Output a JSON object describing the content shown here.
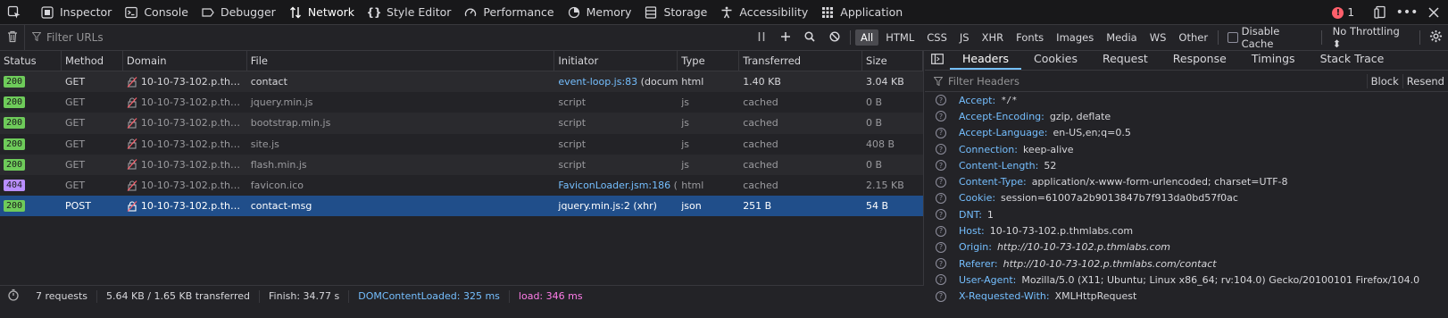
{
  "toolbar": {
    "tools": [
      {
        "label": "Inspector",
        "icon": "inspector-icon"
      },
      {
        "label": "Console",
        "icon": "console-icon"
      },
      {
        "label": "Debugger",
        "icon": "debugger-icon"
      },
      {
        "label": "Network",
        "icon": "network-icon",
        "selected": true
      },
      {
        "label": "Style Editor",
        "icon": "style-editor-icon"
      },
      {
        "label": "Performance",
        "icon": "performance-icon"
      },
      {
        "label": "Memory",
        "icon": "memory-icon"
      },
      {
        "label": "Storage",
        "icon": "storage-icon"
      },
      {
        "label": "Accessibility",
        "icon": "accessibility-icon"
      },
      {
        "label": "Application",
        "icon": "application-icon"
      }
    ],
    "error_count": "1"
  },
  "filterbar": {
    "filter_placeholder": "Filter URLs",
    "types": [
      "All",
      "HTML",
      "CSS",
      "JS",
      "XHR",
      "Fonts",
      "Images",
      "Media",
      "WS",
      "Other"
    ],
    "active_type": "All",
    "disable_cache_label": "Disable Cache",
    "throttling_label": "No Throttling ⬍"
  },
  "columns": [
    "Status",
    "Method",
    "Domain",
    "File",
    "Initiator",
    "Type",
    "Transferred",
    "Size"
  ],
  "requests": [
    {
      "status": "200",
      "method": "GET",
      "domain": "10-10-73-102.p.thmla…",
      "file": "contact",
      "initiator_link": "event-loop.js:83",
      "initiator_rest": " (docum…",
      "type": "html",
      "transferred": "1.40 KB",
      "size": "3.04 KB",
      "cached": false
    },
    {
      "status": "200",
      "method": "GET",
      "domain": "10-10-73-102.p.thmla…",
      "file": "jquery.min.js",
      "initiator_link": "",
      "initiator_rest": "script",
      "type": "js",
      "transferred": "cached",
      "size": "0 B",
      "cached": true
    },
    {
      "status": "200",
      "method": "GET",
      "domain": "10-10-73-102.p.thmla…",
      "file": "bootstrap.min.js",
      "initiator_link": "",
      "initiator_rest": "script",
      "type": "js",
      "transferred": "cached",
      "size": "0 B",
      "cached": true
    },
    {
      "status": "200",
      "method": "GET",
      "domain": "10-10-73-102.p.thmla…",
      "file": "site.js",
      "initiator_link": "",
      "initiator_rest": "script",
      "type": "js",
      "transferred": "cached",
      "size": "408 B",
      "cached": true
    },
    {
      "status": "200",
      "method": "GET",
      "domain": "10-10-73-102.p.thmla…",
      "file": "flash.min.js",
      "initiator_link": "",
      "initiator_rest": "script",
      "type": "js",
      "transferred": "cached",
      "size": "0 B",
      "cached": true
    },
    {
      "status": "404",
      "method": "GET",
      "domain": "10-10-73-102.p.thmla…",
      "file": "favicon.ico",
      "initiator_link": "FaviconLoader.jsm:186",
      "initiator_rest": " (i…",
      "type": "html",
      "transferred": "cached",
      "size": "2.15 KB",
      "cached": true
    },
    {
      "status": "200",
      "method": "POST",
      "domain": "10-10-73-102.p.thmla…",
      "file": "contact-msg",
      "initiator_link": "",
      "initiator_rest": "jquery.min.js:2 (xhr)",
      "type": "json",
      "transferred": "251 B",
      "size": "54 B",
      "cached": false,
      "selected": true
    }
  ],
  "summary": {
    "requests": "7 requests",
    "transferred": "5.64 KB / 1.65 KB transferred",
    "finish": "Finish: 34.77 s",
    "dcl": "DOMContentLoaded: 325 ms",
    "load": "load: 346 ms"
  },
  "side_tabs": [
    "Headers",
    "Cookies",
    "Request",
    "Response",
    "Timings",
    "Stack Trace"
  ],
  "active_side_tab": "Headers",
  "headers_filter_placeholder": "Filter Headers",
  "block_label": "Block",
  "resend_label": "Resend",
  "headers": [
    {
      "name": "Accept:",
      "value": "*/*",
      "style": "mono"
    },
    {
      "name": "Accept-Encoding:",
      "value": "gzip, deflate"
    },
    {
      "name": "Accept-Language:",
      "value": "en-US,en;q=0.5"
    },
    {
      "name": "Connection:",
      "value": "keep-alive"
    },
    {
      "name": "Content-Length:",
      "value": "52"
    },
    {
      "name": "Content-Type:",
      "value": "application/x-www-form-urlencoded; charset=UTF-8"
    },
    {
      "name": "Cookie:",
      "value": "session=61007a2b9013847b7f913da0bd57f0ac"
    },
    {
      "name": "DNT:",
      "value": "1"
    },
    {
      "name": "Host:",
      "value": "10-10-73-102.p.thmlabs.com"
    },
    {
      "name": "Origin:",
      "value": "http://10-10-73-102.p.thmlabs.com",
      "style": "italic"
    },
    {
      "name": "Referer:",
      "value": "http://10-10-73-102.p.thmlabs.com/contact",
      "style": "italic"
    },
    {
      "name": "User-Agent:",
      "value": "Mozilla/5.0 (X11; Ubuntu; Linux x86_64; rv:104.0) Gecko/20100101 Firefox/104.0"
    },
    {
      "name": "X-Requested-With:",
      "value": "XMLHttpRequest"
    }
  ],
  "colors": {
    "status_200": "#6ecb5a",
    "status_404": "#b98eff",
    "selected_row": "#204e8a",
    "link": "#75bfff"
  }
}
